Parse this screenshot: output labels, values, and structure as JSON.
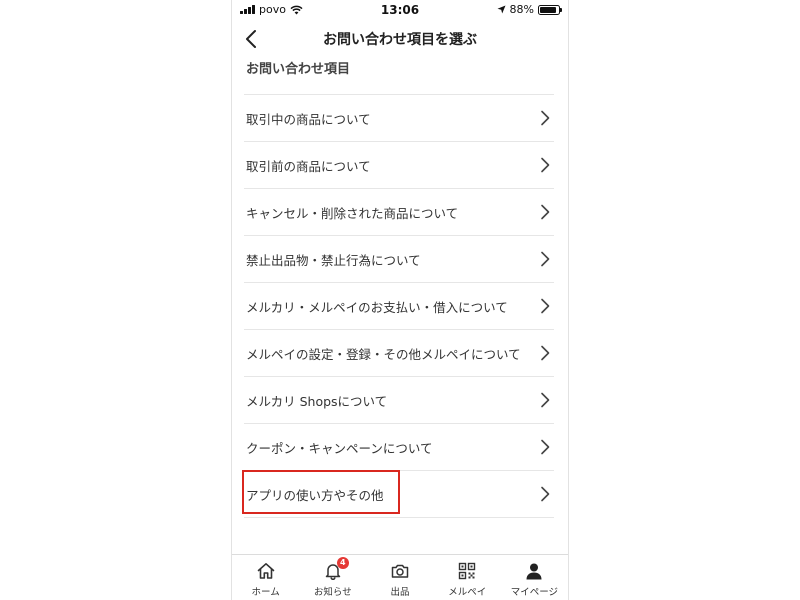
{
  "status_bar": {
    "carrier": "povo",
    "time": "13:06",
    "battery": "88%",
    "battery_level": 0.88
  },
  "nav": {
    "title": "お問い合わせ項目を選ぶ",
    "back_icon": "chevron-left-icon"
  },
  "section": {
    "header": "お問い合わせ項目"
  },
  "menu": {
    "items": [
      {
        "label": "取引中の商品について"
      },
      {
        "label": "取引前の商品について"
      },
      {
        "label": "キャンセル・削除された商品について"
      },
      {
        "label": "禁止出品物・禁止行為について"
      },
      {
        "label": "メルカリ・メルペイのお支払い・借入について"
      },
      {
        "label": "メルペイの設定・登録・その他メルペイについて"
      },
      {
        "label": "メルカリ Shopsについて"
      },
      {
        "label": "クーポン・キャンペーンについて"
      },
      {
        "label": "アプリの使い方やその他"
      }
    ],
    "highlighted_index": 8,
    "highlight_color": "#d9271f"
  },
  "tab_bar": {
    "tabs": [
      {
        "label": "ホーム",
        "icon": "home-icon"
      },
      {
        "label": "お知らせ",
        "icon": "bell-icon",
        "badge": "4"
      },
      {
        "label": "出品",
        "icon": "camera-icon"
      },
      {
        "label": "メルペイ",
        "icon": "qr-code-icon"
      },
      {
        "label": "マイページ",
        "icon": "person-icon"
      }
    ],
    "badge_color": "#e53935"
  }
}
